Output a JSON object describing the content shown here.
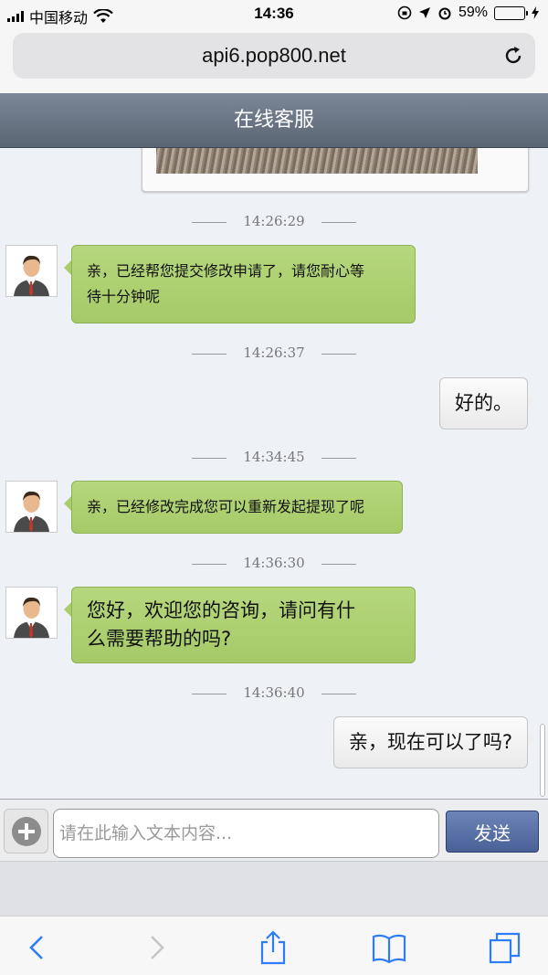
{
  "status_bar": {
    "carrier": "中国移动",
    "time": "14:36",
    "battery_percent": "59%",
    "battery_level": 0.59
  },
  "browser": {
    "url": "api6.pop800.net"
  },
  "header": {
    "title": "在线客服"
  },
  "messages": [
    {
      "timestamp": "14:26:29",
      "from": "agent",
      "text_lines": [
        "亲，已经帮您提交修改申请了，请您耐心等",
        "待十分钟呢"
      ]
    },
    {
      "timestamp": "14:26:37",
      "from": "user",
      "text": "好的。"
    },
    {
      "timestamp": "14:34:45",
      "from": "agent",
      "text_lines": [
        "亲，已经修改完成您可以重新发起提现了呢"
      ]
    },
    {
      "timestamp": "14:36:30",
      "from": "agent",
      "text_lines": [
        "您好，欢迎您的咨询，请问有什",
        "么需要帮助的吗?"
      ]
    },
    {
      "timestamp": "14:36:40",
      "from": "user",
      "text": "亲，现在可以了吗?"
    }
  ],
  "composer": {
    "placeholder": "请在此输入文本内容...",
    "send_label": "发送"
  },
  "colors": {
    "agent_bubble": "#a9cd6d",
    "user_bubble": "#efefef",
    "header": "#5a6574",
    "send_button": "#4a6198"
  }
}
